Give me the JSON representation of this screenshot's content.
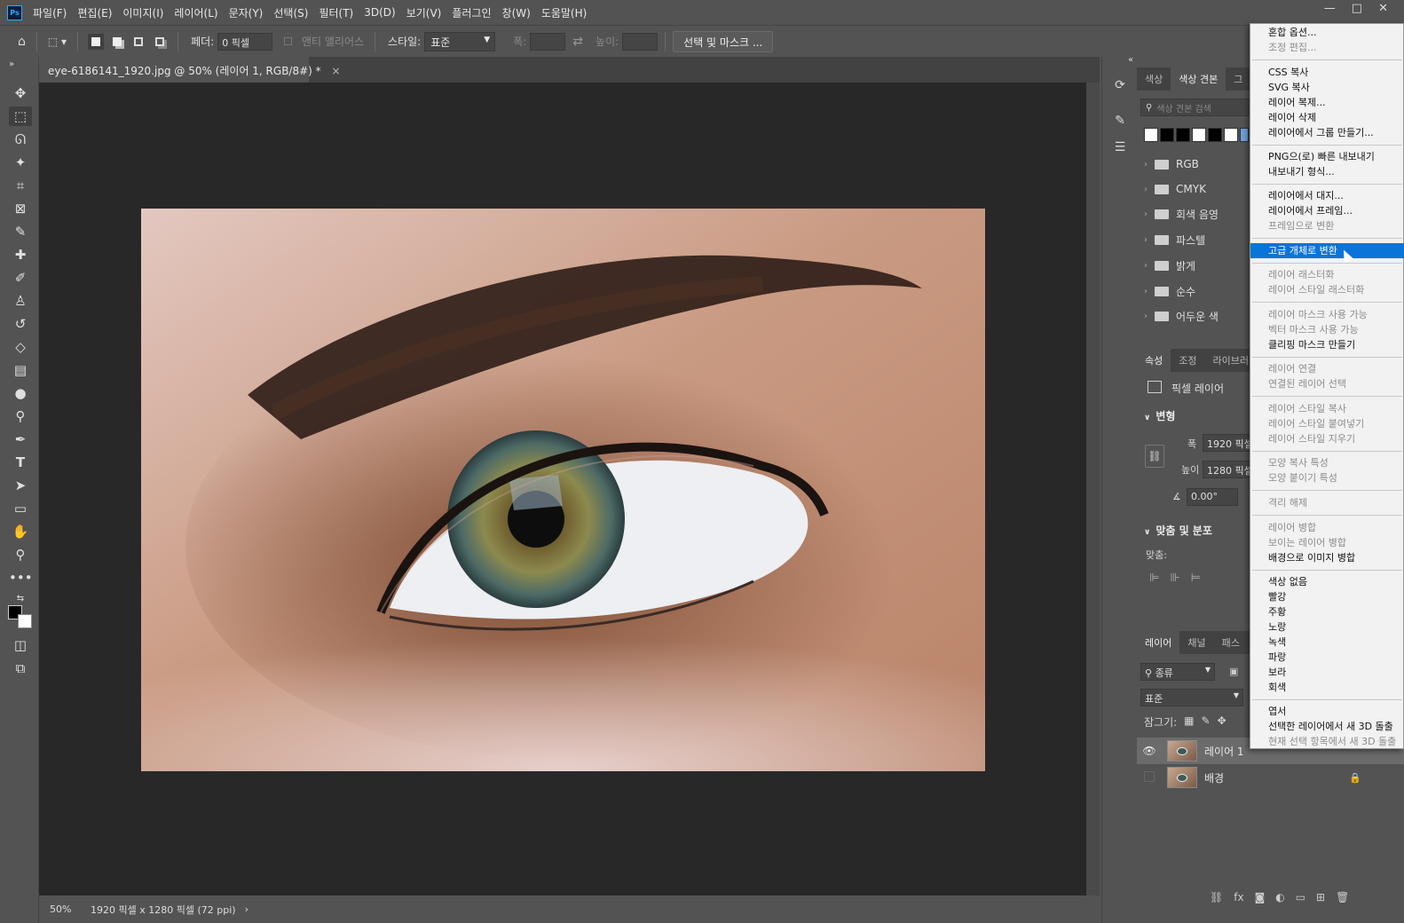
{
  "app": {
    "logo": "Ps",
    "menu": [
      "파일(F)",
      "편집(E)",
      "이미지(I)",
      "레이어(L)",
      "문자(Y)",
      "선택(S)",
      "필터(T)",
      "3D(D)",
      "보기(V)",
      "플러그인",
      "창(W)",
      "도움말(H)"
    ],
    "window_controls": [
      "—",
      "□",
      "✕"
    ]
  },
  "options_bar": {
    "feather_label": "페더:",
    "feather_value": "0 픽셀",
    "antialias_label": "앤티 앨리어스",
    "style_label": "스타일:",
    "style_value": "표준",
    "width_label": "폭:",
    "height_label": "높이:",
    "select_mask_button": "선택 및 마스크 ..."
  },
  "document": {
    "tab_title": "eye-6186141_1920.jpg @ 50% (레이어 1, RGB/8#) *",
    "zoom": "50%",
    "doc_info": "1920 픽셀 x 1280 픽셀 (72 ppi)"
  },
  "swatches_panel": {
    "tabs": [
      "색상",
      "색상 견본",
      "그"
    ],
    "search_placeholder": "색상 견본 검색",
    "swatch_colors": [
      "#ffffff",
      "#000000",
      "#000000",
      "#ffffff",
      "#000000",
      "#ffffff",
      "#6f9fd8"
    ],
    "folders": [
      "RGB",
      "CMYK",
      "회색 음영",
      "파스텔",
      "밝게",
      "순수",
      "어두운 색"
    ]
  },
  "properties_panel": {
    "tabs": [
      "속성",
      "조정",
      "라이브러"
    ],
    "layer_type": "픽셀 레이어",
    "transform_header": "변형",
    "width_label": "폭",
    "width_value": "1920 픽셀",
    "height_label": "높이",
    "height_value": "1280 픽셀",
    "angle_value": "0.00°",
    "align_header": "맞춤 및 분포",
    "align_label": "맞춤:"
  },
  "layers_panel": {
    "tabs": [
      "레이어",
      "채널",
      "패스"
    ],
    "filter_label": "종류",
    "blend_mode": "표준",
    "lock_label": "잠그기:",
    "layers": [
      {
        "name": "레이어 1"
      },
      {
        "name": "배경"
      }
    ]
  },
  "context_menu": {
    "items": [
      {
        "label": "혼합 옵션...",
        "disabled": false
      },
      {
        "label": "조정 편집...",
        "disabled": true
      },
      {
        "label": "CSS 복사",
        "disabled": false
      },
      {
        "label": "SVG 복사",
        "disabled": false
      },
      {
        "label": "레이어 복제...",
        "disabled": false
      },
      {
        "label": "레이어 삭제",
        "disabled": false
      },
      {
        "label": "레이어에서 그룹 만들기...",
        "disabled": false
      },
      {
        "label": "PNG으(로) 빠른 내보내기",
        "disabled": false
      },
      {
        "label": "내보내기 형식...",
        "disabled": false
      },
      {
        "label": "레이어에서 대지...",
        "disabled": false
      },
      {
        "label": "레이어에서 프레임...",
        "disabled": false
      },
      {
        "label": "프레임으로 변환",
        "disabled": true
      },
      {
        "label": "고급 개체로 변환",
        "disabled": false,
        "highlighted": true
      },
      {
        "label": "레이어 래스터화",
        "disabled": true
      },
      {
        "label": "레이어 스타일 래스터화",
        "disabled": true
      },
      {
        "label": "레이어 마스크 사용 가능",
        "disabled": true
      },
      {
        "label": "벡터 마스크 사용 가능",
        "disabled": true
      },
      {
        "label": "클리핑 마스크 만들기",
        "disabled": false
      },
      {
        "label": "레이어 연결",
        "disabled": true
      },
      {
        "label": "연결된 레이어 선택",
        "disabled": true
      },
      {
        "label": "레이어 스타일 복사",
        "disabled": true
      },
      {
        "label": "레이어 스타일 붙여넣기",
        "disabled": true
      },
      {
        "label": "레이어 스타일 지우기",
        "disabled": true
      },
      {
        "label": "모양 복사 특성",
        "disabled": true
      },
      {
        "label": "모양 붙이기 특성",
        "disabled": true
      },
      {
        "label": "격리 해제",
        "disabled": true
      },
      {
        "label": "레이어 병합",
        "disabled": true
      },
      {
        "label": "보이는 레이어 병합",
        "disabled": true
      },
      {
        "label": "배경으로 이미지 병합",
        "disabled": false
      },
      {
        "label": "색상 없음",
        "disabled": false
      },
      {
        "label": "빨강",
        "disabled": false
      },
      {
        "label": "주황",
        "disabled": false
      },
      {
        "label": "노랑",
        "disabled": false
      },
      {
        "label": "녹색",
        "disabled": false
      },
      {
        "label": "파랑",
        "disabled": false
      },
      {
        "label": "보라",
        "disabled": false
      },
      {
        "label": "회색",
        "disabled": false
      },
      {
        "label": "엽서",
        "disabled": false
      },
      {
        "label": "선택한 레이어에서 새 3D 돌출",
        "disabled": false
      },
      {
        "label": "현재 선택 항목에서 새 3D 돌출",
        "disabled": true
      }
    ]
  }
}
